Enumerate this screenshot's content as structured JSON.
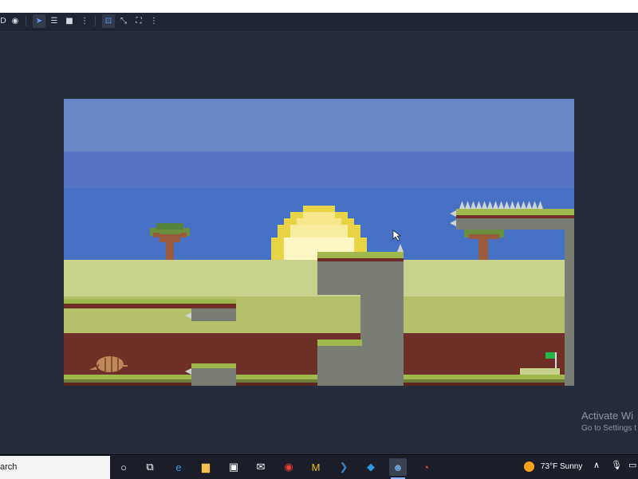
{
  "toolbar": {
    "tools": [
      {
        "name": "eye-icon",
        "glyph": "◉"
      },
      {
        "name": "select-pointer-icon",
        "glyph": "➤"
      },
      {
        "name": "list-select-icon",
        "glyph": "☰"
      },
      {
        "name": "camera-icon",
        "glyph": "■"
      },
      {
        "name": "more-options-icon",
        "glyph": "⋮"
      },
      {
        "name": "focus-frame-icon",
        "glyph": "⊡"
      },
      {
        "name": "expand-icon",
        "glyph": "⤡"
      },
      {
        "name": "fullscreen-icon",
        "glyph": "⛶"
      },
      {
        "name": "more-options-icon-2",
        "glyph": "⋮"
      }
    ],
    "left_label": "D"
  },
  "watermark": {
    "line1": "Activate Wi",
    "line2": "Go to Settings t"
  },
  "taskbar": {
    "search_text": "arch",
    "weather_text": "73°F  Sunny",
    "apps": [
      {
        "name": "cortana-icon",
        "glyph": "○"
      },
      {
        "name": "task-view-icon",
        "glyph": "⧉"
      },
      {
        "name": "edge-icon",
        "glyph": "e",
        "color": "#2f97e8"
      },
      {
        "name": "file-explorer-icon",
        "glyph": "▆",
        "color": "#f2c14e"
      },
      {
        "name": "store-icon",
        "glyph": "▣",
        "color": "#ffffff"
      },
      {
        "name": "mail-icon",
        "glyph": "✉",
        "color": "#ffffff"
      },
      {
        "name": "chrome-icon",
        "glyph": "◉",
        "color": "#e94235"
      },
      {
        "name": "m-app-icon",
        "glyph": "M",
        "color": "#e6c100"
      },
      {
        "name": "powershell-icon",
        "glyph": "❯",
        "color": "#3b82c4"
      },
      {
        "name": "vscode-icon",
        "glyph": "◆",
        "color": "#2a9ae0"
      },
      {
        "name": "godot-icon",
        "glyph": "☻",
        "color": "#6ba5d6"
      },
      {
        "name": "record-app-icon",
        "glyph": "◔",
        "color": "#e84545"
      }
    ],
    "tray": [
      {
        "name": "tray-chevron-icon",
        "glyph": "∧"
      },
      {
        "name": "microphone-icon",
        "glyph": "🎙"
      },
      {
        "name": "network-icon",
        "glyph": "▭"
      }
    ]
  },
  "colors": {
    "sky_top": "#6787c7",
    "sky_mid": "#5676c3",
    "sky_low": "#4671c5",
    "sun_outer": "#e9d448",
    "sun_inner": "#fbf6c2",
    "hill_light": "#c9d28d",
    "hill_mid": "#b6c06a",
    "dirt": "#6e2f26",
    "grass": "#9fb84d",
    "stone": "#7a7d74"
  }
}
